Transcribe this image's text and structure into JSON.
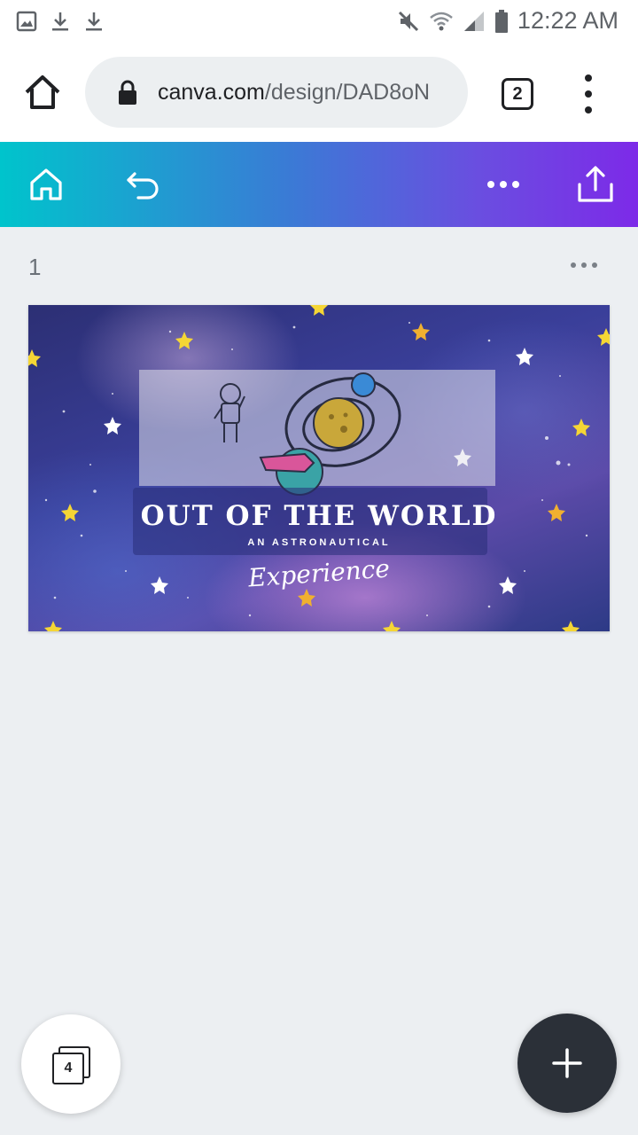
{
  "status_bar": {
    "time": "12:22 AM",
    "left_icons": [
      "image-icon",
      "download-icon",
      "download-icon"
    ],
    "right_icons": [
      "mute-icon",
      "wifi-icon",
      "signal-icon",
      "battery-icon"
    ]
  },
  "browser": {
    "url_host": "canva.com",
    "url_path": "/design/DAD8oN",
    "tab_count": "2"
  },
  "editor_toolbar": {
    "colors": {
      "gradient_start": "#00c4cc",
      "gradient_end": "#7d2ae8"
    },
    "icons": [
      "home-icon",
      "undo-icon",
      "more-icon",
      "share-icon"
    ]
  },
  "page": {
    "number": "1",
    "design": {
      "title": "OUT OF THE WORLD",
      "subtitle": "AN ASTRONAUTICAL",
      "script": "Experience"
    }
  },
  "fabs": {
    "page_count": "4"
  }
}
